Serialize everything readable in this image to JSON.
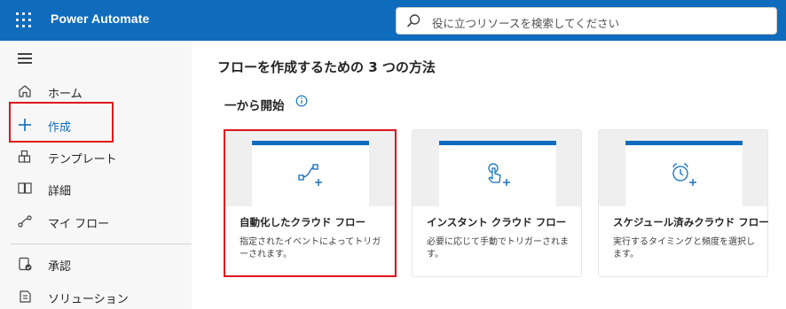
{
  "app": {
    "title": "Power Automate"
  },
  "search": {
    "placeholder": "役に立つリソースを検索してください"
  },
  "nav": {
    "items": [
      {
        "label": "ホーム",
        "icon": "home-icon"
      },
      {
        "label": "作成",
        "icon": "plus-icon"
      },
      {
        "label": "テンプレート",
        "icon": "templates-icon"
      },
      {
        "label": "詳細",
        "icon": "book-icon"
      },
      {
        "label": "マイ フロー",
        "icon": "flow-icon"
      },
      {
        "label": "承認",
        "icon": "approvals-icon"
      },
      {
        "label": "ソリューション",
        "icon": "solutions-icon"
      }
    ]
  },
  "main": {
    "page_title": "フローを作成するための 3 つの方法",
    "section_title": "一から開始",
    "cards": [
      {
        "title": "自動化したクラウド フロー",
        "description": "指定されたイベントによってトリガーされます。",
        "icon": "automated-flow-icon"
      },
      {
        "title": "インスタント クラウド フロー",
        "description": "必要に応じて手動でトリガーされます。",
        "icon": "instant-flow-icon"
      },
      {
        "title": "スケジュール済みクラウド フロー",
        "description": "実行するタイミングと頻度を選択します。",
        "icon": "scheduled-flow-icon"
      }
    ]
  },
  "colors": {
    "brand": "#0f6cbd",
    "highlight": "#e0141c"
  }
}
